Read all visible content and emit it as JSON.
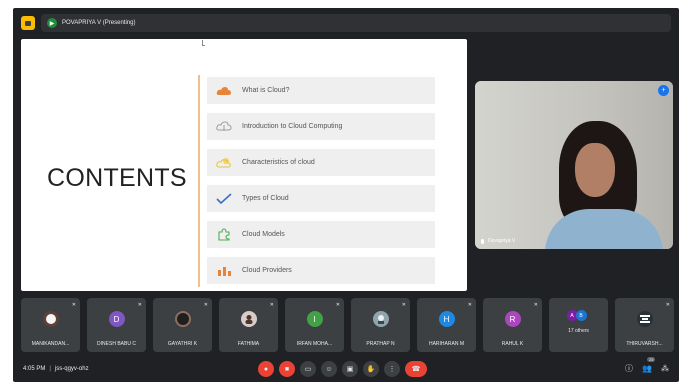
{
  "topbar": {
    "presenter_label": "POVAPRIYA V (Presenting)"
  },
  "slide": {
    "title": "CONTENTS",
    "topics": [
      {
        "label": "What is Cloud?",
        "icon": "cloud-icon",
        "color": "#e8833a"
      },
      {
        "label": "Introduction to Cloud Computing",
        "icon": "cloud-outline-icon",
        "color": "#9e9e9e"
      },
      {
        "label": "Characteristics of cloud",
        "icon": "cloud-sun-icon",
        "color": "#e7c240"
      },
      {
        "label": "Types of Cloud",
        "icon": "check-icon",
        "color": "#3b6fc4"
      },
      {
        "label": "Cloud Models",
        "icon": "puzzle-icon",
        "color": "#4caf50"
      },
      {
        "label": "Cloud Providers",
        "icon": "bar-chart-icon",
        "color": "#e8833a"
      }
    ]
  },
  "speaker": {
    "name": "Devapriya V"
  },
  "participants": [
    {
      "name": "MANIKANDAN...",
      "initial": "",
      "color": "#2b2b2b"
    },
    {
      "name": "DINESH BABU C",
      "initial": "D",
      "color": "#7e57c2"
    },
    {
      "name": "GAYATHRI K",
      "initial": "",
      "color": "#1f1f1f"
    },
    {
      "name": "FATHIMA",
      "initial": "",
      "color": "#d7ccc8"
    },
    {
      "name": "IRFAN MOHA...",
      "initial": "I",
      "color": "#43a047"
    },
    {
      "name": "PRATHAP N",
      "initial": "",
      "color": "#607d8b"
    },
    {
      "name": "HARIHARAN M",
      "initial": "H",
      "color": "#1e88e5"
    },
    {
      "name": "RAHUL K",
      "initial": "R",
      "color": "#ab47bc"
    }
  ],
  "others": {
    "label": "17 others",
    "avatars": [
      {
        "initial": "A",
        "color": "#7b1fa2"
      },
      {
        "initial": "B",
        "color": "#1976d2"
      }
    ]
  },
  "last_tile": {
    "name": "THIRUVARSH..."
  },
  "bottombar": {
    "time": "4:05 PM",
    "separator": "|",
    "meeting_code": "jss-qgyv-ohz",
    "people_badge": "25"
  }
}
